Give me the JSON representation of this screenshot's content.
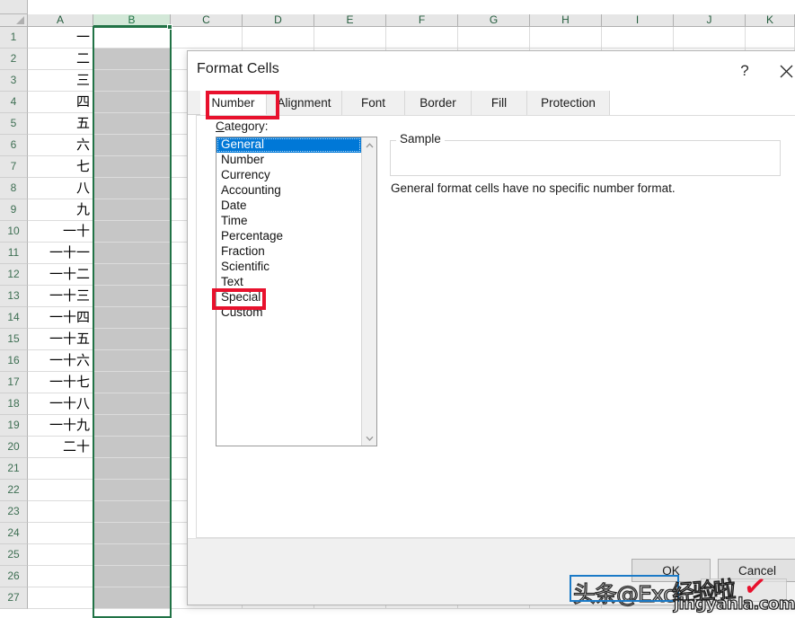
{
  "spreadsheet": {
    "columns": [
      "A",
      "B",
      "C",
      "D",
      "E",
      "F",
      "G",
      "H",
      "I",
      "J",
      "K"
    ],
    "selected_column": "B",
    "rows": [
      "1",
      "2",
      "3",
      "4",
      "5",
      "6",
      "7",
      "8",
      "9",
      "10",
      "11",
      "12",
      "13",
      "14",
      "15",
      "16",
      "17",
      "18",
      "19",
      "20",
      "21",
      "22",
      "23",
      "24",
      "25",
      "26",
      "27"
    ],
    "column_a_values": [
      "一",
      "二",
      "三",
      "四",
      "五",
      "六",
      "七",
      "八",
      "九",
      "一十",
      "一十一",
      "一十二",
      "一十三",
      "一十四",
      "一十五",
      "一十六",
      "一十七",
      "一十八",
      "一十九",
      "二十",
      "",
      "",
      "",
      "",
      "",
      "",
      ""
    ],
    "select_all_icon": "select-all-triangle",
    "accent_color": "#217346",
    "selection_fill": "#c6c6c6"
  },
  "dialog": {
    "title": "Format Cells",
    "help_icon": "question-mark-icon",
    "close_icon": "close-icon",
    "tabs": [
      {
        "label": "Number",
        "active": true
      },
      {
        "label": "Alignment",
        "active": false
      },
      {
        "label": "Font",
        "active": false
      },
      {
        "label": "Border",
        "active": false
      },
      {
        "label": "Fill",
        "active": false
      },
      {
        "label": "Protection",
        "active": false
      }
    ],
    "category": {
      "label": "Category:",
      "label_accel": "C",
      "label_rest": "ategory:",
      "items": [
        "General",
        "Number",
        "Currency",
        "Accounting",
        "Date",
        "Time",
        "Percentage",
        "Fraction",
        "Scientific",
        "Text",
        "Special",
        "Custom"
      ],
      "selected": "General",
      "highlight_color": "#0078d7",
      "scroll_up_icon": "chevron-up-icon",
      "scroll_down_icon": "chevron-down-icon"
    },
    "sample": {
      "legend": "Sample",
      "value": "",
      "description": "General format cells have no specific number format."
    },
    "buttons": {
      "ok": "OK",
      "cancel": "Cancel"
    }
  },
  "annotations": {
    "color": "#e8112d",
    "highlight_tab": "Number",
    "highlight_category": "Special"
  },
  "watermark": {
    "text_left": "头条@Exc",
    "text_right": "经验啦",
    "url": "jingyanla.com",
    "check_icon": "check-mark-icon"
  }
}
